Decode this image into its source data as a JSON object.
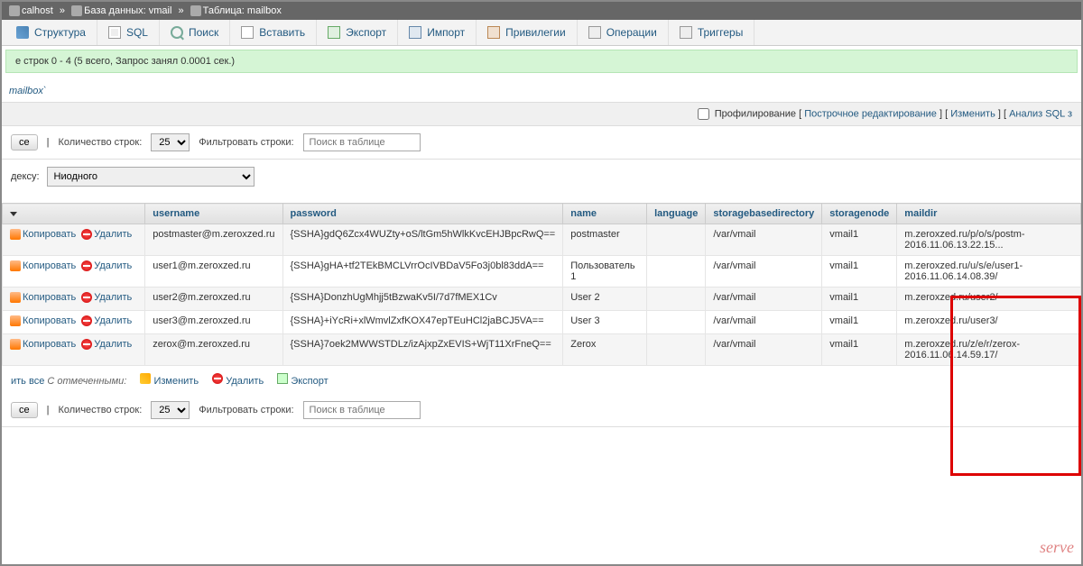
{
  "breadcrumb": {
    "host": "calhost",
    "db_label": "База данных:",
    "db": "vmail",
    "tbl_label": "Таблица:",
    "tbl": "mailbox"
  },
  "tabs": [
    {
      "label": "Структура"
    },
    {
      "label": "SQL"
    },
    {
      "label": "Поиск"
    },
    {
      "label": "Вставить"
    },
    {
      "label": "Экспорт"
    },
    {
      "label": "Импорт"
    },
    {
      "label": "Привилегии"
    },
    {
      "label": "Операции"
    },
    {
      "label": "Триггеры"
    }
  ],
  "status": "е строк 0 - 4 (5 всего, Запрос занял 0.0001 сек.)",
  "query": "mailbox`",
  "topbar": {
    "profiling": "Профилирование",
    "inline": "Построчное редактирование",
    "edit": "Изменить",
    "explain": "Анализ SQL з"
  },
  "controls": {
    "all_btn": "се",
    "rowcount_label": "Количество строк:",
    "rowcount_value": "25",
    "filter_label": "Фильтровать строки:",
    "filter_placeholder": "Поиск в таблице"
  },
  "sort": {
    "label": "дексу:",
    "value": "Ниодного"
  },
  "headers": {
    "username": "username",
    "password": "password",
    "name": "name",
    "language": "language",
    "storagebasedirectory": "storagebasedirectory",
    "storagenode": "storagenode",
    "maildir": "maildir"
  },
  "actions": {
    "copy": "Копировать",
    "delete": "Удалить",
    "edit": "Изменить",
    "export": "Экспорт"
  },
  "rows": [
    {
      "username": "postmaster@m.zeroxzed.ru",
      "password": "{SSHA}gdQ6Zcx4WUZty+oS/ltGm5hWlkKvcEHJBpcRwQ==",
      "name": "postmaster",
      "language": "",
      "storagebasedirectory": "/var/vmail",
      "storagenode": "vmail1",
      "maildir": "m.zeroxzed.ru/p/o/s/postm-2016.11.06.13.22.15..."
    },
    {
      "username": "user1@m.zeroxzed.ru",
      "password": "{SSHA}gHA+tf2TEkBMCLVrrOcIVBDaV5Fo3j0bl83ddA==",
      "name": "Пользователь 1",
      "language": "",
      "storagebasedirectory": "/var/vmail",
      "storagenode": "vmail1",
      "maildir": "m.zeroxzed.ru/u/s/e/user1-2016.11.06.14.08.39/"
    },
    {
      "username": "user2@m.zeroxzed.ru",
      "password": "{SSHA}DonzhUgMhjj5tBzwaKv5I/7d7fMEX1Cv",
      "name": "User 2",
      "language": "",
      "storagebasedirectory": "/var/vmail",
      "storagenode": "vmail1",
      "maildir": "m.zeroxzed.ru/user2/"
    },
    {
      "username": "user3@m.zeroxzed.ru",
      "password": "{SSHA}+iYcRi+xlWmvlZxfKOX47epTEuHCl2jaBCJ5VA==",
      "name": "User 3",
      "language": "",
      "storagebasedirectory": "/var/vmail",
      "storagenode": "vmail1",
      "maildir": "m.zeroxzed.ru/user3/"
    },
    {
      "username": "zerox@m.zeroxzed.ru",
      "password": "{SSHA}7oek2MWWSTDLz/izAjxpZxEVIS+WjT11XrFneQ==",
      "name": "Zerox",
      "language": "",
      "storagebasedirectory": "/var/vmail",
      "storagenode": "vmail1",
      "maildir": "m.zeroxzed.ru/z/e/r/zerox-2016.11.06.14.59.17/"
    }
  ],
  "bottom": {
    "check_all": "ить все",
    "with_selected": "С отмеченными:"
  },
  "watermark": "serve"
}
